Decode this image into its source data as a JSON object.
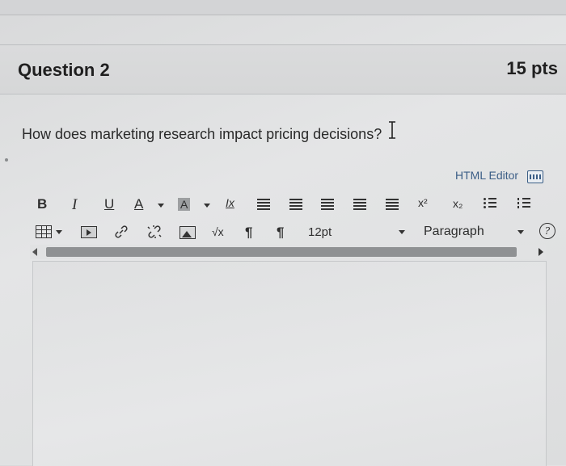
{
  "question": {
    "title": "Question 2",
    "points": "15 pts",
    "text": "How does marketing research impact pricing decisions?"
  },
  "editor": {
    "html_editor_label": "HTML Editor",
    "toolbar_row1": {
      "bold": "B",
      "italic": "I",
      "underline": "U",
      "font_color": "A",
      "background_color": "A",
      "clear_formatting": "Ix",
      "superscript": "x²",
      "subscript": "x₂"
    },
    "toolbar_row2": {
      "equation": "√x",
      "ltr": "¶",
      "rtl": "¶",
      "font_size": "12pt",
      "block_format": "Paragraph"
    },
    "content": ""
  },
  "icons": {
    "align_left": "align-left-icon",
    "align_center": "align-center-icon",
    "align_right": "align-right-icon",
    "outdent": "outdent-icon",
    "indent": "indent-icon",
    "bullet_list": "bullet-list-icon",
    "numbered_list": "numbered-list-icon",
    "table": "table-icon",
    "media": "media-icon",
    "link": "link-icon",
    "unlink": "unlink-icon",
    "image": "image-icon",
    "keyboard": "keyboard-icon",
    "help": "help-icon"
  },
  "colors": {
    "link_blue": "#3b5e86",
    "text_dark": "#1f1f1f",
    "scroll_thumb": "#8f9193"
  }
}
